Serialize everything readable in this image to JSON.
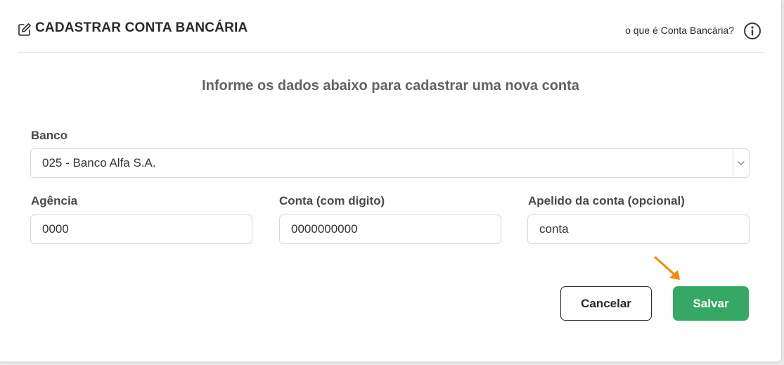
{
  "header": {
    "title": "CADASTRAR CONTA BANCÁRIA",
    "help_link": "o que é Conta Bancária?"
  },
  "subtitle": "Informe os dados abaixo para cadastrar uma nova conta",
  "form": {
    "banco": {
      "label": "Banco",
      "selected": "025 - Banco Alfa S.A."
    },
    "agencia": {
      "label": "Agência",
      "value": "0000"
    },
    "conta": {
      "label": "Conta (com digito)",
      "value": "0000000000"
    },
    "apelido": {
      "label": "Apelido da conta (opcional)",
      "value": "conta"
    }
  },
  "actions": {
    "cancel_label": "Cancelar",
    "save_label": "Salvar"
  },
  "colors": {
    "save_button": "#35a863",
    "annotation_arrow": "#f58a07"
  },
  "icons": {
    "title_icon": "edit-icon",
    "help_icon": "info-icon",
    "select_icon": "chevron-down-icon",
    "annotation": "arrow-annotation-icon"
  }
}
